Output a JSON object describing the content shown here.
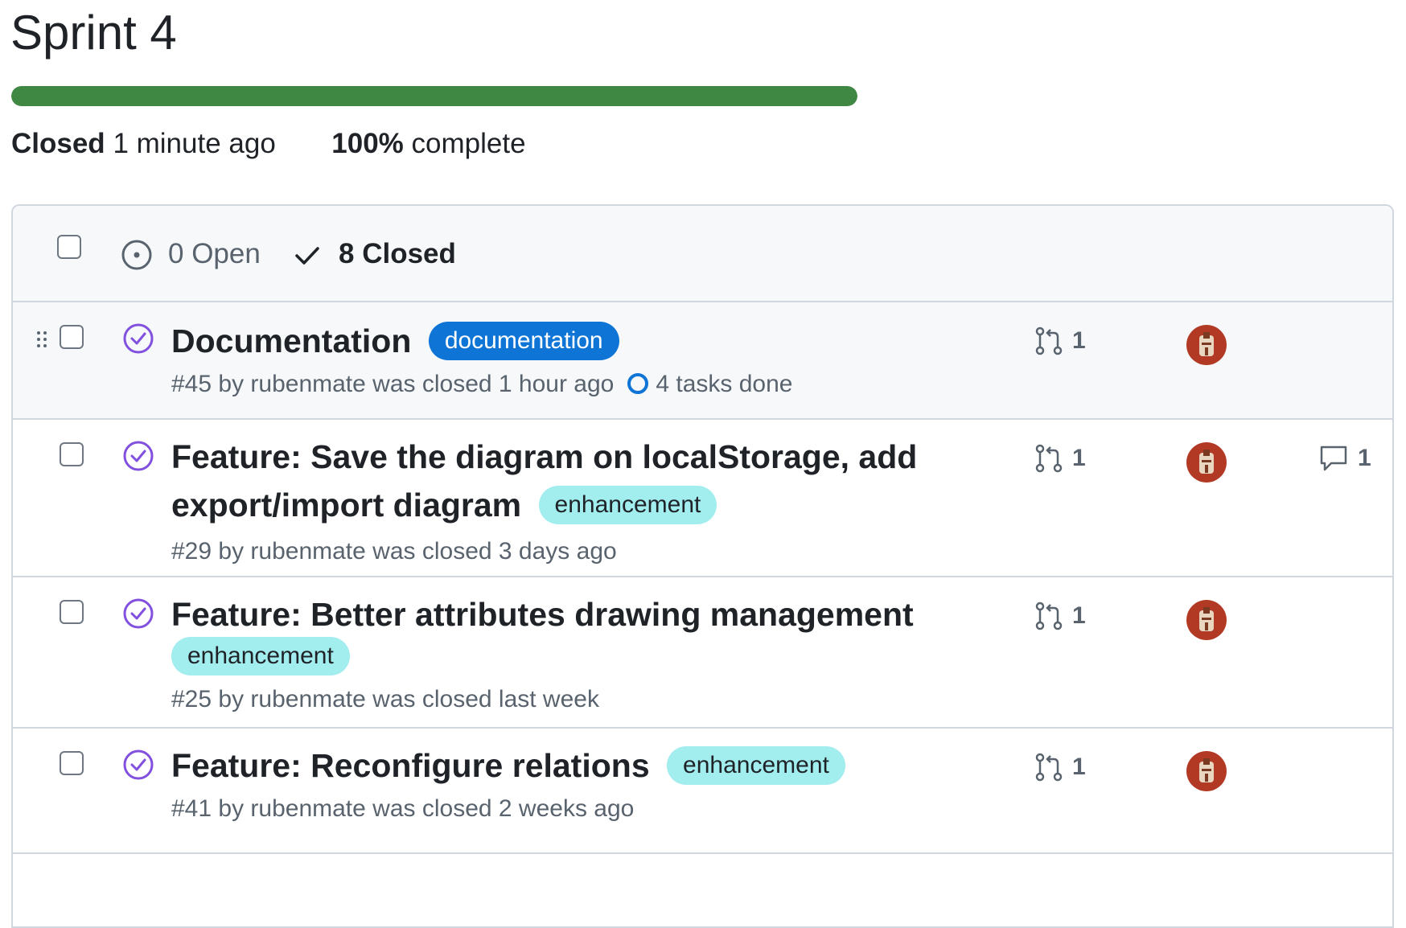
{
  "milestone": {
    "title": "Sprint 4",
    "progress_fraction": 1.0,
    "status_label": "Closed",
    "status_time": "1 minute ago",
    "percent_label": "100%",
    "percent_suffix": "complete"
  },
  "filters": {
    "open_label": "0 Open",
    "closed_label": "8 Closed"
  },
  "issues": [
    {
      "title": "Documentation",
      "label": "documentation",
      "meta": "#45 by rubenmate was closed 1 hour ago",
      "tasks": "4 tasks done",
      "pr_count": "1",
      "comment_count": ""
    },
    {
      "title_line1": "Feature: Save the diagram on localStorage, add",
      "title_line2": "export/import diagram",
      "label": "enhancement",
      "meta": "#29 by rubenmate was closed 3 days ago",
      "pr_count": "1",
      "comment_count": "1"
    },
    {
      "title": "Feature: Better attributes drawing management",
      "label": "enhancement",
      "meta": "#25 by rubenmate was closed last week",
      "pr_count": "1"
    },
    {
      "title": "Feature: Reconfigure relations",
      "label": "enhancement",
      "meta": "#41 by rubenmate was closed 2 weeks ago",
      "pr_count": "1"
    }
  ],
  "colors": {
    "progress": "#3f8844",
    "closed_icon": "#8250df",
    "label_documentation": "#0e75d6",
    "label_enhancement": "#a2eeef",
    "avatar": "#b23a24"
  },
  "icons": {
    "open": "issue-opened-icon",
    "closed_check": "check-icon",
    "issue_closed": "issue-closed-icon",
    "pull_request": "git-pull-request-icon",
    "comment": "comment-icon",
    "tasks": "task-progress-icon",
    "drag": "grabber-icon"
  }
}
